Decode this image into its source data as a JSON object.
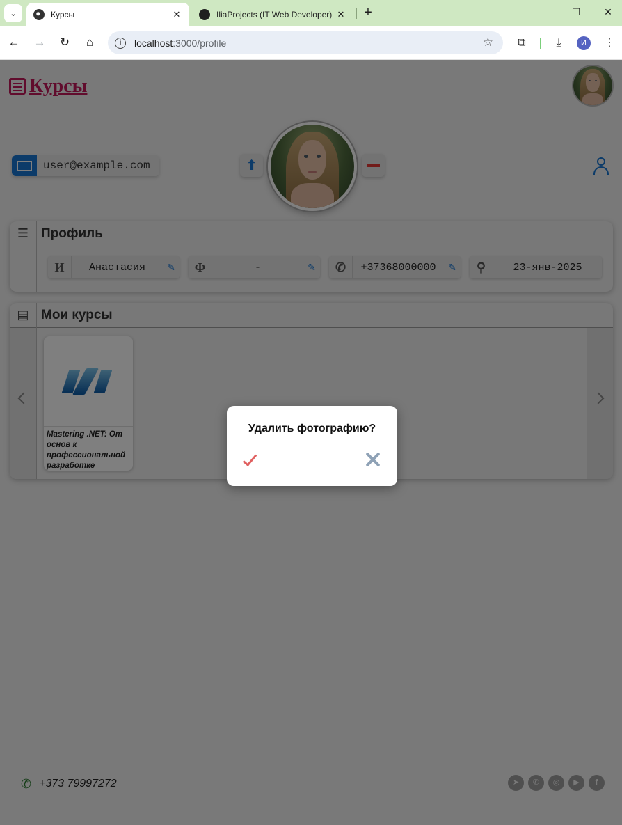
{
  "browser": {
    "tabs": [
      {
        "title": "Курсы",
        "close": "✕"
      },
      {
        "title": "IliaProjects (IT Web Developer)",
        "close": "✕"
      }
    ],
    "new_tab": "+",
    "window": {
      "minimize": "—",
      "maximize": "☐",
      "close": "✕"
    },
    "url_host": "localhost",
    "url_rest": ":3000/profile",
    "profile_initial": "И"
  },
  "header": {
    "logo_text": "Курсы"
  },
  "profile_top": {
    "email": "user@example.com",
    "upload_icon": "⬆"
  },
  "profile_panel": {
    "title": "Профиль",
    "fields": [
      {
        "label": "И",
        "value": "Анастасия"
      },
      {
        "label": "Ф",
        "value": "-"
      },
      {
        "label": "",
        "value": "+37368000000"
      },
      {
        "label": "",
        "value": "23-янв-2025"
      }
    ]
  },
  "courses_panel": {
    "title": "Мои курсы",
    "courses": [
      {
        "title": "Mastering .NET: От основ к профессиональной разработке"
      }
    ]
  },
  "footer": {
    "phone": "+373 79997272",
    "socials": [
      "telegram-icon",
      "viber-icon",
      "instagram-icon",
      "youtube-icon",
      "facebook-icon"
    ]
  },
  "dialog": {
    "title": "Удалить фотографию?"
  }
}
